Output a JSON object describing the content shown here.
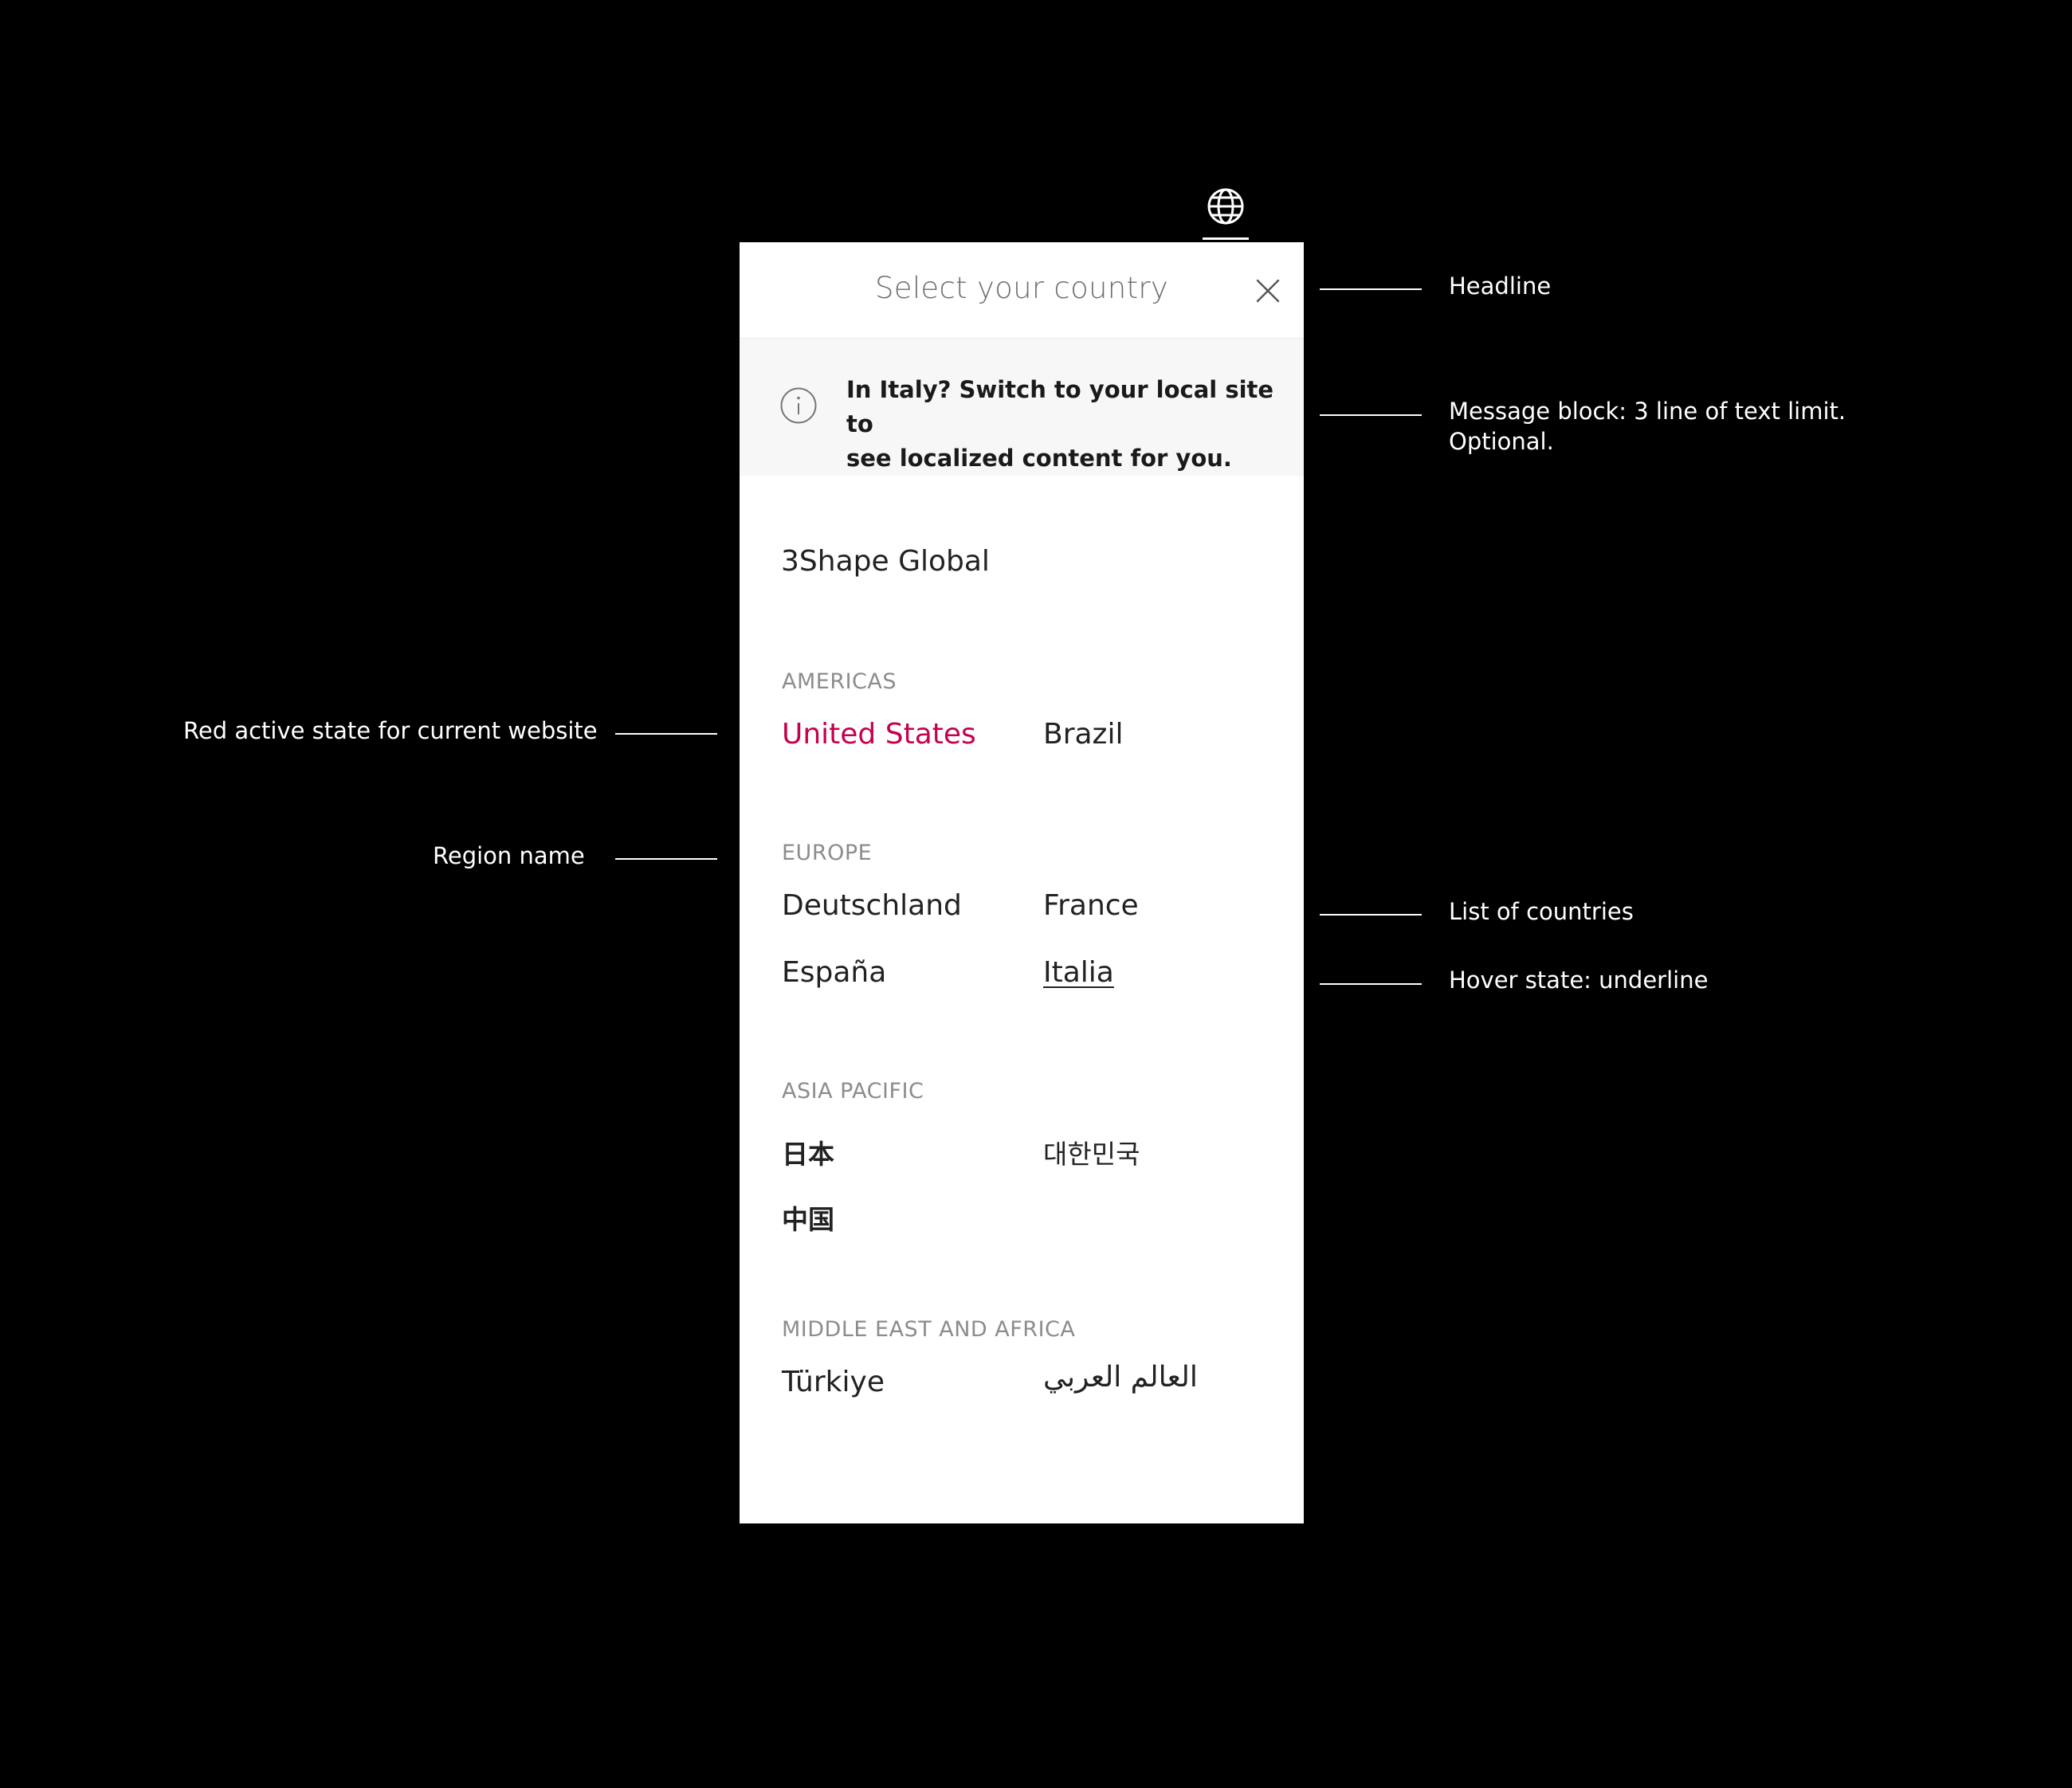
{
  "header": {
    "globe_icon": "globe-icon"
  },
  "panel": {
    "title": "Select your country",
    "close_icon": "close-icon",
    "message": {
      "icon": "info-icon",
      "text_line1": "In Italy? Switch to your local site to",
      "text_line2": "see localized content for you."
    },
    "global_link": "3Shape Global",
    "regions": [
      {
        "name": "AMERICAS",
        "countries": [
          "United States",
          "Brazil"
        ]
      },
      {
        "name": "EUROPE",
        "countries": [
          "Deutschland",
          "France",
          "España",
          "Italia"
        ]
      },
      {
        "name": "ASIA PACIFIC",
        "countries": [
          "日本",
          "대한민국",
          "中国"
        ]
      },
      {
        "name": "MIDDLE EAST AND AFRICA",
        "countries": [
          "Türkiye",
          "العالم العربي"
        ]
      }
    ],
    "active_country": "United States",
    "hover_country": "Italia",
    "colors": {
      "active": "#c4024f",
      "panel_bg": "#ffffff",
      "message_bg": "#f7f7f7",
      "page_bg": "#000000"
    }
  },
  "annotations": {
    "headline": "Headline",
    "message_block_line1": "Message block: 3 line of text limit.",
    "message_block_line2": "Optional.",
    "active_state": "Red active state for current website",
    "region_name": "Region name",
    "list_of_countries": "List of countries",
    "hover_state": "Hover state: underline"
  }
}
